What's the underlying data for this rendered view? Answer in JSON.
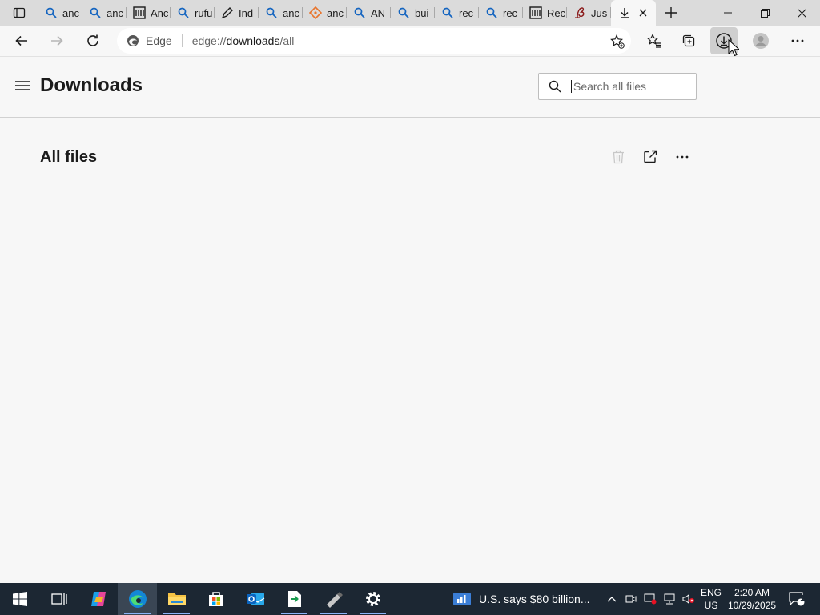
{
  "browser": {
    "tabs": [
      {
        "title": "anc",
        "favicon": "search-icon",
        "color": "#1565c0"
      },
      {
        "title": "anc",
        "favicon": "search-icon",
        "color": "#1565c0"
      },
      {
        "title": "Anc",
        "favicon": "library-icon",
        "color": "#1b1b1b"
      },
      {
        "title": "rufu",
        "favicon": "search-icon",
        "color": "#1565c0"
      },
      {
        "title": "Ind",
        "favicon": "pen-icon",
        "color": "#1b1b1b"
      },
      {
        "title": "anc",
        "favicon": "search-icon",
        "color": "#1565c0"
      },
      {
        "title": "anc",
        "favicon": "diamond-icon",
        "color": "#e8742c"
      },
      {
        "title": "AN",
        "favicon": "search-icon",
        "color": "#1565c0"
      },
      {
        "title": "bui",
        "favicon": "search-icon",
        "color": "#1565c0"
      },
      {
        "title": "rec",
        "favicon": "search-icon",
        "color": "#1565c0"
      },
      {
        "title": "rec",
        "favicon": "search-icon",
        "color": "#1565c0"
      },
      {
        "title": "Rec",
        "favicon": "library-icon",
        "color": "#1b1b1b"
      },
      {
        "title": "Jus",
        "favicon": "script-icon",
        "color": "#8b1a1a"
      }
    ],
    "active_tab": {
      "title": "",
      "favicon": "download-icon"
    },
    "address": {
      "site_label": "Edge",
      "url_prefix": "edge://",
      "url_host": "downloads",
      "url_path": "/all"
    }
  },
  "page": {
    "title": "Downloads",
    "search_placeholder": "Search all files",
    "section_title": "All files"
  },
  "taskbar": {
    "news": "U.S. says $80 billion...",
    "lang_line1": "ENG",
    "lang_line2": "US",
    "time": "2:20 AM",
    "date": "10/29/2025",
    "notification_count": "1"
  },
  "colors": {
    "accent": "#0067c0",
    "tab_strip": "#dbdbdb",
    "page_bg": "#f7f7f7",
    "taskbar": "#1c2733"
  }
}
